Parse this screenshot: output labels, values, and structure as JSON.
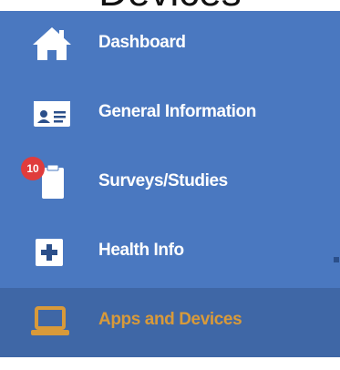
{
  "header": {
    "title": "Devices"
  },
  "sidebar": {
    "items": [
      {
        "label": "Dashboard",
        "icon": "home-icon"
      },
      {
        "label": "General Information",
        "icon": "id-card-icon"
      },
      {
        "label": "Surveys/Studies",
        "icon": "clipboard-icon",
        "badge": "10"
      },
      {
        "label": "Health Info",
        "icon": "plus-square-icon"
      },
      {
        "label": "Apps and Devices",
        "icon": "laptop-icon",
        "active": true
      }
    ]
  },
  "colors": {
    "sidebar_bg": "#4a78c0",
    "active_bg": "#3f67a6",
    "active_text": "#d89a3a",
    "badge_bg": "#e03c3c"
  }
}
